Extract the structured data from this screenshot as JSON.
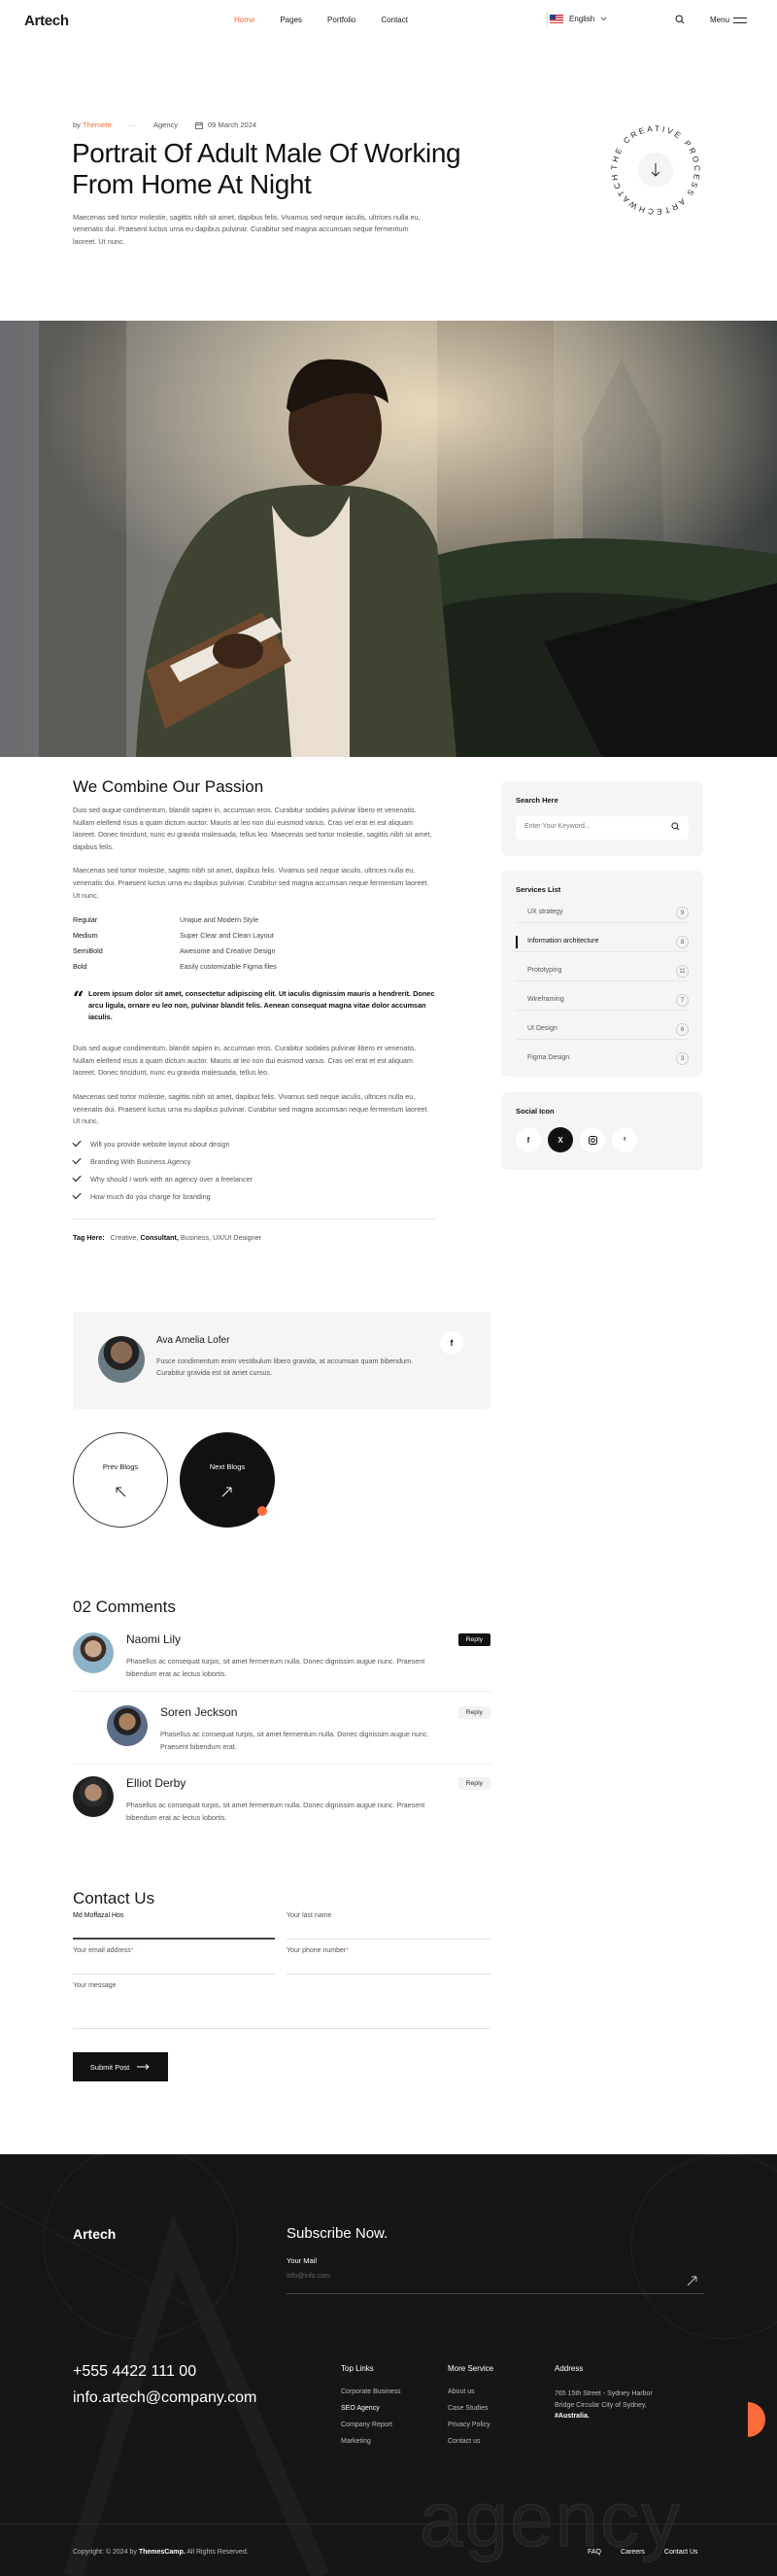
{
  "header": {
    "logo": "Artech",
    "nav": [
      "Home",
      "Pages",
      "Portfolio",
      "Contact"
    ],
    "active_nav": "Home",
    "language": "English",
    "menu_label": "Menu"
  },
  "post": {
    "by_label": "by",
    "author": "Themeht",
    "category": "Agency",
    "date": "09 March 2024",
    "title": "Portrait Of Adult Male Of Working From Home At Night",
    "intro": "Maecenas sed tortor molestie, sagittis nibh sit amet, dapibus felis. Vivamus sed neque iaculis, ultrices nulla eu, venenatis dui. Praesent luctus urna eu dapibus pulvinar. Curabitur sed magna accumsan neque fermentum laoreet. Ut nunc.",
    "badge_text": "THE CREATIVE PROCESS ARTECHWATCH"
  },
  "article": {
    "heading": "We Combine Our Passion",
    "para1": "Duis sed augue condimentum, blandit sapien in, accumsan eros. Curabitur sodales pulvinar libero et venenatis. Nullam eleifend risus a quam dictum auctor. Mauris at leo non dui euismod varius. Cras vel erat et est aliquam laoreet. Donec tincidunt, nunc eu gravida malesuada, tellus leo. Maecenas sed tortor molestie, sagittis nibh sit amet, dapibus felis.",
    "para2": "Maecenas sed tortor molestie, sagittis nibh sit amet, dapibus felis. Vivamus sed neque iaculis, ultrices nulla eu, venenatis dui. Praesent luctus urna eu dapibus pulvinar. Curabitur sed magna accumsan neque fermentum laoreet. Ut nunc.",
    "table": [
      {
        "k": "Regular",
        "v": "Unique and Modern Style"
      },
      {
        "k": "Medium",
        "v": "Super Clear and Clean Layout"
      },
      {
        "k": "SemiBold",
        "v": "Awesome and Creative Design"
      },
      {
        "k": "Bold",
        "v": "Easily customizable Figma files"
      }
    ],
    "quote": "Lorem ipsum dolor sit amet, consectetur adipiscing elit. Ut iaculis dignissim mauris a hendrerit. Donec arcu ligula, ornare eu leo non, pulvinar blandit felis. Aenean consequat magna vitae dolor accumsan iaculis.",
    "para3": "Duis sed augue condimentum, blandit sapien in, accumsan eros. Curabitur sodales pulvinar libero et venenatis. Nullam eleifend risus a quam dictum auctor. Mauris at leo non dui euismod varius. Cras vel erat et est aliquam laoreet. Donec tincidunt, nunc eu gravida malesuada, tellus leo.",
    "para4": "Maecenas sed tortor molestie, sagittis nibh sit amet, dapibus felis. Vivamus sed neque iaculis, ultrices nulla eu, venenatis dui. Praesent luctus urna eu dapibus pulvinar. Curabitur sed magna accumsan neque fermentum laoreet. Ut nunc.",
    "checklist": [
      "Will you provide website layout about design",
      "Branding With Business Agency",
      "Why should I work with an agency over a freelancer",
      "How much do you charge for branding"
    ],
    "tags_label": "Tag Here:",
    "tags": [
      "Creative,",
      "Consultant,",
      "Business,",
      "UX/UI Designer"
    ]
  },
  "author_box": {
    "name": "Ava Amelia Lofer",
    "bio": "Fusce condimentum enim vestibulum libero gravida, at accumsan quam bibendum. Curabitur gravida est sit amet cursus.",
    "social": "f"
  },
  "pager": {
    "prev": "Prev Blogs",
    "next": "Next Blogs"
  },
  "comments": {
    "heading": "02 Comments",
    "items": [
      {
        "name": "Naomi Lily",
        "text": "Phasellus ac consequat turpis, sit amet fermentum nulla. Donec dignissim augue nunc. Praesent bibendum erat ac lectus lobortis.",
        "reply": "Reply"
      },
      {
        "name": "Soren Jeckson",
        "text": "Phasellus ac consequat turpis, sit amet fermentum nulla. Donec dignissim augue nunc. Praesent bibendum erat.",
        "reply": "Reply"
      },
      {
        "name": "Elliot Derby",
        "text": "Phasellus ac consequat turpis, sit amet fermentum nulla. Donec dignissim augue nunc. Praesent bibendum erat ac lectus lobortis.",
        "reply": "Reply"
      }
    ]
  },
  "contact": {
    "heading": "Contact Us",
    "first_name": "Md Moffazal Hos",
    "last_name": "Your last name",
    "email": "Your email address",
    "phone": "Your phone number",
    "message": "Your message",
    "required": "*",
    "submit": "Submit Post"
  },
  "sidebar": {
    "search_title": "Search Here",
    "search_placeholder": "Enter Your Keyword...",
    "services_title": "Services List",
    "services": [
      {
        "label": "UX strategy",
        "count": "9"
      },
      {
        "label": "Information architecture",
        "count": "8"
      },
      {
        "label": "Prototyping",
        "count": "11"
      },
      {
        "label": "Wireframing",
        "count": "7"
      },
      {
        "label": "UI Design",
        "count": "6"
      },
      {
        "label": "Figma Design",
        "count": "3"
      }
    ],
    "active_service": "Information architecture",
    "social_title": "Social Icon",
    "social": [
      "f",
      "X",
      "ig",
      "p"
    ]
  },
  "footer": {
    "logo": "Artech",
    "subscribe_heading": "Subscribe Now.",
    "mail_label": "Your Mail",
    "mail_placeholder": "info@info.com",
    "phone": "+555 4422 111 00",
    "email": "info.artech@company.com",
    "col1_title": "Top Links",
    "col1": [
      "Corporate Business",
      "SEO Agency",
      "Company Report",
      "Marketing"
    ],
    "col2_title": "More Service",
    "col2": [
      "About us",
      "Case Studies",
      "Privacy Policy",
      "Contact us"
    ],
    "col3_title": "Address",
    "address_line1": "765 15th Street - Sydney Harbor",
    "address_line2": "Bridge Circular City of Sydney,",
    "address_line3": "#Australia.",
    "copyright_pre": "Copyright: © 2024 by",
    "copyright_brand": "ThemesCamp.",
    "copyright_post": "All Rights Reserved.",
    "bottom_links": [
      "FAQ",
      "Careers",
      "Contact Us"
    ],
    "watermark": "agency"
  },
  "colors": {
    "accent": "#ff6a3a",
    "dark": "#161616",
    "panel": "#f5f5f5"
  }
}
